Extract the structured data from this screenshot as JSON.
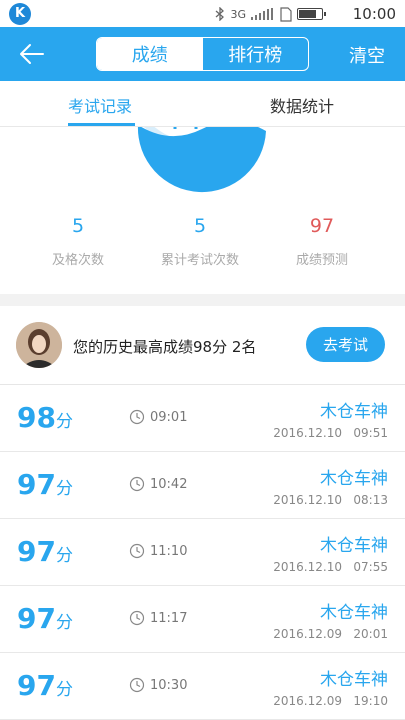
{
  "status_bar": {
    "logo": "K",
    "network": "3G",
    "time": "10:00"
  },
  "header": {
    "tabs": [
      "成绩",
      "排行榜"
    ],
    "clear_label": "清空"
  },
  "subtabs": {
    "records_label": "考试记录",
    "stats_label": "数据统计"
  },
  "stats": [
    {
      "value": "5",
      "label": "及格次数",
      "color": "#29a6ee"
    },
    {
      "value": "5",
      "label": "累计考试次数",
      "color": "#29a6ee"
    },
    {
      "value": "97",
      "label": "成绩预测",
      "color": "#e05a5a"
    }
  ],
  "best": {
    "text": "您的历史最高成绩98分  2名",
    "button_label": "去考试"
  },
  "records": [
    {
      "score": "98",
      "unit": "分",
      "duration": "09:01",
      "nickname": "木仓车神",
      "datetime": "2016.12.10   09:51"
    },
    {
      "score": "97",
      "unit": "分",
      "duration": "10:42",
      "nickname": "木仓车神",
      "datetime": "2016.12.10   08:13"
    },
    {
      "score": "97",
      "unit": "分",
      "duration": "11:10",
      "nickname": "木仓车神",
      "datetime": "2016.12.10   07:55"
    },
    {
      "score": "97",
      "unit": "分",
      "duration": "11:17",
      "nickname": "木仓车神",
      "datetime": "2016.12.09   20:01"
    },
    {
      "score": "97",
      "unit": "分",
      "duration": "10:30",
      "nickname": "木仓车神",
      "datetime": "2016.12.09   19:10"
    }
  ],
  "colors": {
    "accent": "#29a6ee",
    "prediction": "#e05a5a"
  },
  "icons": {
    "back": "arrow-left-icon",
    "clock": "clock-icon"
  }
}
